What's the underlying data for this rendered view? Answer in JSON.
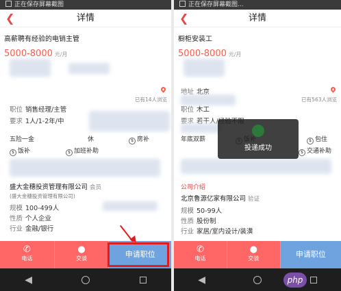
{
  "left": {
    "statusbar": "正在保存屏幕截图",
    "title": "详情",
    "job_title": "高薪聘有经验的电销主管",
    "salary": "5000-8000",
    "salary_unit": "元/月",
    "views": "已有14人浏览",
    "position_label": "职位",
    "position_value": "销售经理/主管",
    "req_label": "要求",
    "req_value": "1人/1-2年/中",
    "benefits": [
      "五险一金",
      "饭补",
      "加班补助",
      "房补"
    ],
    "benefit_partial": "休",
    "company_name": "盛大金穗投资管理有限公司",
    "company_member": "会员",
    "company_sub": "(盛大金穗投资管理有限公司)",
    "scale_label": "规模",
    "scale_value": "100-499人",
    "nature_label": "性质",
    "nature_value": "个人企业",
    "industry_label": "行业",
    "industry_value": "金融/银行",
    "btn_call": "电话",
    "btn_chat": "交谈",
    "btn_apply": "申请职位"
  },
  "right": {
    "statusbar": "正在保存屏幕截图...",
    "title": "详情",
    "job_title": "橱柜安装工",
    "salary": "5000-8000",
    "salary_unit": "元/月",
    "views": "已有563人浏览",
    "addr_label": "地址",
    "addr_value": "北京",
    "position_label": "职位",
    "position_value": "木工",
    "req_label": "要求",
    "req_value": "若干人/经验不限",
    "benefit_first": "年底双薪",
    "benefits": [
      "饭补",
      "包住",
      "交通补助"
    ],
    "toast": "投递成功",
    "section_label": "公司介绍",
    "company_name": "北京鲁源亿家有限公司",
    "company_verified": "验证",
    "scale_label": "规模",
    "scale_value": "50-99人",
    "nature_label": "性质",
    "nature_value": "股份制",
    "industry_label": "行业",
    "industry_value": "家居/室内设计/装潢",
    "btn_call": "电话",
    "btn_chat": "交谈",
    "btn_apply": "申请职位"
  },
  "watermark": "php"
}
